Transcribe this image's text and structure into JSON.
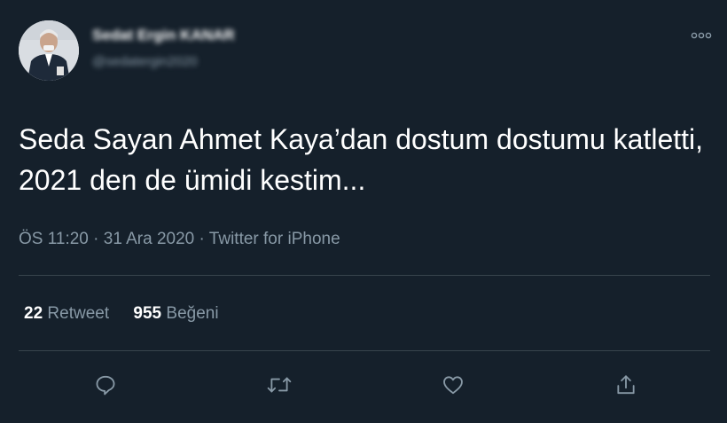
{
  "author": {
    "display_name": "Sedat Ergin KANAR",
    "handle": "@sedatergin2020"
  },
  "tweet": {
    "lines": [
      "Seda Sayan Ahmet Kaya’dan dostum dostumu katletti,",
      "2021 den de ümidi kestim..."
    ],
    "time": "ÖS 11:20",
    "date": "31 Ara 2020",
    "source": "Twitter for iPhone",
    "separator": "·"
  },
  "stats": {
    "retweet_count": "22",
    "retweet_label": "Retweet",
    "like_count": "955",
    "like_label": "Beğeni"
  },
  "icons": {
    "more": "more-icon",
    "reply": "reply-icon",
    "retweet": "retweet-icon",
    "like": "like-icon",
    "share": "share-icon"
  },
  "colors": {
    "background": "#15202b",
    "text": "#ffffff",
    "muted": "#8899a6",
    "divider": "#38444d"
  }
}
